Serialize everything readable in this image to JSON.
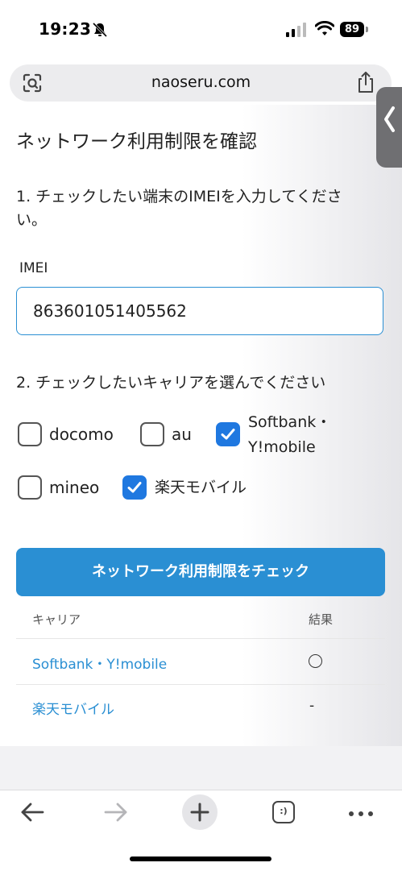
{
  "status": {
    "time": "19:23",
    "battery": "89"
  },
  "browser": {
    "url": "naoseru.com"
  },
  "page": {
    "title": "ネットワーク利用制限を確認",
    "step1": "1. チェックしたい端末のIMEIを入力してください。",
    "imei_label": "IMEI",
    "imei_value": "863601051405562",
    "step2": "2. チェックしたいキャリアを選んでください",
    "carriers": [
      {
        "label": "docomo",
        "checked": false
      },
      {
        "label": "au",
        "checked": false
      },
      {
        "label": "Softbank・Y!mobile",
        "checked": true
      },
      {
        "label": "mineo",
        "checked": false
      },
      {
        "label": "楽天モバイル",
        "checked": true
      }
    ],
    "check_button": "ネットワーク利用制限をチェック",
    "results_table": {
      "headers": [
        "キャリア",
        "結果"
      ],
      "rows": [
        {
          "carrier": "Softbank・Y!mobile",
          "result": "○"
        },
        {
          "carrier": "楽天モバイル",
          "result": "-"
        }
      ]
    }
  },
  "toolbar": {
    "tabs_label": ":)"
  },
  "colors": {
    "accent": "#2a8fd3",
    "checkbox_checked": "#1f78e0"
  }
}
